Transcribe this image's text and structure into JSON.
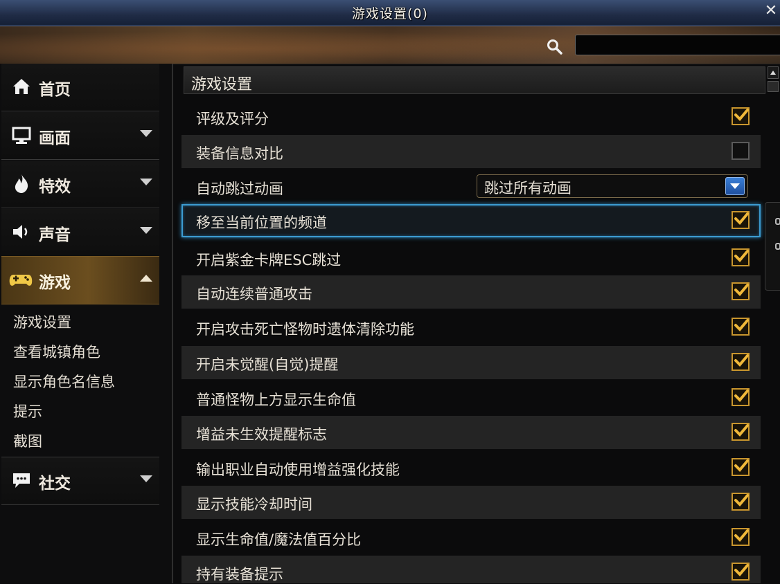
{
  "window": {
    "title": "游戏设置(0)",
    "close_label": "✕"
  },
  "search": {
    "placeholder": ""
  },
  "sidebar": {
    "nav": [
      {
        "id": "home",
        "label": "首页",
        "icon": "home-icon"
      },
      {
        "id": "display",
        "label": "画面",
        "icon": "monitor-icon"
      },
      {
        "id": "effects",
        "label": "特效",
        "icon": "flame-icon"
      },
      {
        "id": "sound",
        "label": "声音",
        "icon": "speaker-icon"
      },
      {
        "id": "game",
        "label": "游戏",
        "icon": "gamepad-icon",
        "active": true
      },
      {
        "id": "social",
        "label": "社交",
        "icon": "chat-icon"
      }
    ],
    "sub_items": [
      "游戏设置",
      "查看城镇角色",
      "显示角色名信息",
      "提示",
      "截图"
    ]
  },
  "content": {
    "section_title": "游戏设置",
    "rows": [
      {
        "label": "评级及评分",
        "checked": true
      },
      {
        "label": "装备信息对比",
        "checked": false
      },
      {
        "label": "自动跳过动画",
        "dropdown_value": "跳过所有动画"
      },
      {
        "label": "移至当前位置的频道",
        "checked": true,
        "highlighted": true
      },
      {
        "label": "开启紫金卡牌ESC跳过",
        "checked": true
      },
      {
        "label": "自动连续普通攻击",
        "checked": true
      },
      {
        "label": "开启攻击死亡怪物时遗体清除功能",
        "checked": true
      },
      {
        "label": "开启未觉醒(自觉)提醒",
        "checked": true
      },
      {
        "label": "普通怪物上方显示生命值",
        "checked": true
      },
      {
        "label": "增益未生效提醒标志",
        "checked": true
      },
      {
        "label": "输出职业自动使用增益强化技能",
        "checked": true
      },
      {
        "label": "显示技能冷却时间",
        "checked": true
      },
      {
        "label": "显示生命值/魔法值百分比",
        "checked": true
      },
      {
        "label": "持有装备提示",
        "checked": true
      }
    ]
  },
  "colors": {
    "accent_gold": "#c9962e",
    "highlight_blue": "#3c9bd0",
    "title_bar": "#1f2b45"
  }
}
